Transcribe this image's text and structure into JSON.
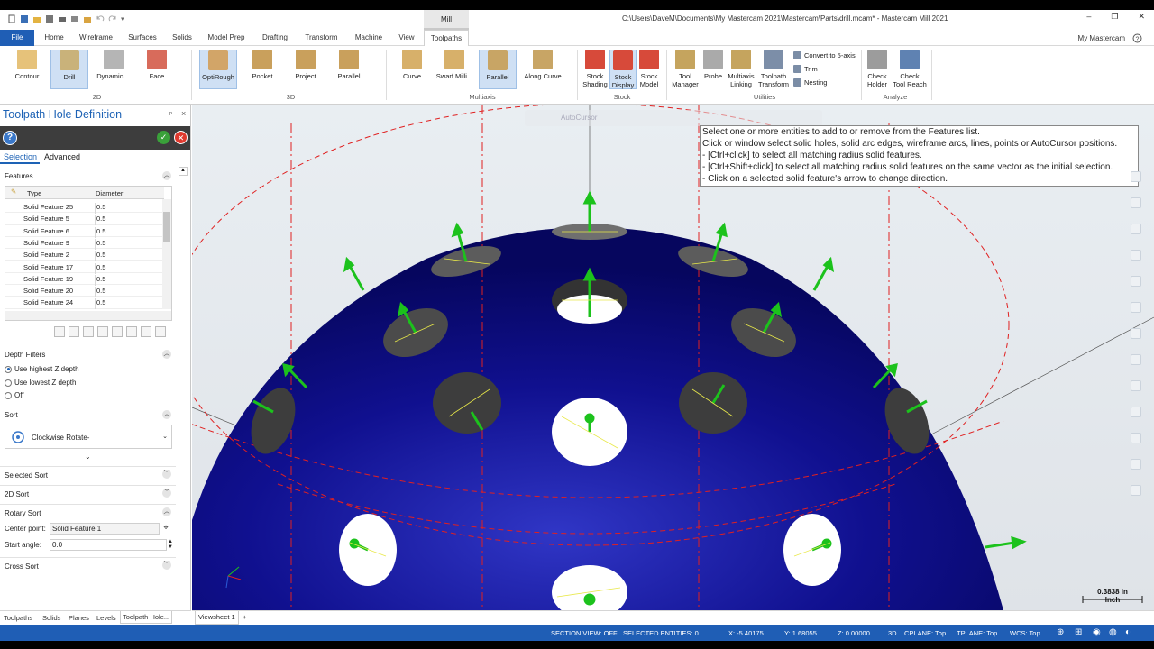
{
  "window": {
    "title": "C:\\Users\\DaveM\\Documents\\My Mastercam 2021\\Mastercam\\Parts\\drill.mcam* - Mastercam Mill 2021",
    "context_tab": "Mill",
    "controls": [
      "–",
      "❐",
      "✕"
    ]
  },
  "tabs": [
    "File",
    "Home",
    "Wireframe",
    "Surfaces",
    "Solids",
    "Model Prep",
    "Drafting",
    "Transform",
    "Machine",
    "View",
    "Toolpaths"
  ],
  "my_mastercam": "My Mastercam",
  "ribbon": {
    "groups": {
      "g2d": "2D",
      "g3d": "3D",
      "multiaxis": "Multiaxis",
      "stock": "Stock",
      "utilities": "Utilities",
      "analyze": "Analyze"
    },
    "buttons_2d": [
      "Contour",
      "Drill",
      "Dynamic ...",
      "Face"
    ],
    "buttons_3d": [
      "OptiRough",
      "Pocket",
      "Project",
      "Parallel"
    ],
    "buttons_multiaxis": [
      "Curve",
      "Swarf Milli...",
      "Parallel",
      "Along Curve"
    ],
    "buttons_stock": [
      [
        "Stock",
        "Shading"
      ],
      [
        "Stock",
        "Display"
      ],
      [
        "Stock",
        "Model"
      ]
    ],
    "buttons_utilities": [
      [
        "Tool",
        "Manager"
      ],
      [
        "Probe",
        ""
      ],
      [
        "Multiaxis",
        "Linking"
      ],
      [
        "Toolpath",
        "Transform"
      ]
    ],
    "small_utilities": [
      "Convert to 5-axis",
      "Trim",
      "Nesting"
    ],
    "buttons_analyze": [
      [
        "Check",
        "Holder"
      ],
      [
        "Check",
        "Tool Reach"
      ]
    ]
  },
  "panel": {
    "title": "Toolpath Hole Definition",
    "pin": "ᵖ",
    "close": "×",
    "help": "?",
    "ok": "✓",
    "cancel": "✕",
    "subtabs": [
      "Selection",
      "Advanced"
    ],
    "features_label": "Features",
    "columns": [
      "Type",
      "Diameter"
    ],
    "rows": [
      {
        "type": "Solid Feature 25",
        "diameter": "0.5"
      },
      {
        "type": "Solid Feature 5",
        "diameter": "0.5"
      },
      {
        "type": "Solid Feature 6",
        "diameter": "0.5"
      },
      {
        "type": "Solid Feature 9",
        "diameter": "0.5"
      },
      {
        "type": "Solid Feature 2",
        "diameter": "0.5"
      },
      {
        "type": "Solid Feature 17",
        "diameter": "0.5"
      },
      {
        "type": "Solid Feature 19",
        "diameter": "0.5"
      },
      {
        "type": "Solid Feature 20",
        "diameter": "0.5"
      },
      {
        "type": "Solid Feature 24",
        "diameter": "0.5"
      }
    ],
    "depth_filters": "Depth Filters",
    "depth_options": [
      "Use highest Z depth",
      "Use lowest Z depth",
      "Off"
    ],
    "depth_selected": 0,
    "sort_label": "Sort",
    "sort_value": "Clockwise Rotate-",
    "sections": [
      "Selected Sort",
      "2D Sort",
      "Rotary Sort"
    ],
    "center_point_label": "Center point:",
    "center_point_value": "Solid Feature 1",
    "start_angle_label": "Start angle:",
    "start_angle_value": "0.0",
    "cross_sort": "Cross Sort",
    "bottom_tabs": [
      "Toolpaths",
      "Solids",
      "Planes",
      "Levels",
      "Toolpath Hole..."
    ]
  },
  "prompt": [
    "Select one or more entities to add to or remove from the Features list.",
    "Click or window select solid holes, solid arc edges, wireframe arcs, lines, points or AutoCursor positions.",
    "- [Ctrl+click] to select all matching radius solid features.",
    "- [Ctrl+Shift+click] to select all matching radius solid features on the same vector as the initial selection.",
    "- Click on a selected solid feature's arrow to change direction."
  ],
  "autocursor": "AutoCursor",
  "scale": {
    "value": "0.3838 in",
    "unit": "Inch"
  },
  "sheet_tab": "Viewsheet 1",
  "sheet_add": "+",
  "status": {
    "section_view": "SECTION VIEW: OFF",
    "selected": "SELECTED ENTITIES: 0",
    "x": "X:   -5.40175",
    "y": "Y:   1.68055",
    "z": "Z:   0.00000",
    "mode": "3D",
    "cplane": "CPLANE: Top",
    "tplane": "TPLANE: Top",
    "wcs": "WCS: Top"
  },
  "colors": {
    "accent": "#1f5eb5",
    "sphere": "#1010a0",
    "arrow": "#1cc21c",
    "dashed": "#e02020"
  }
}
